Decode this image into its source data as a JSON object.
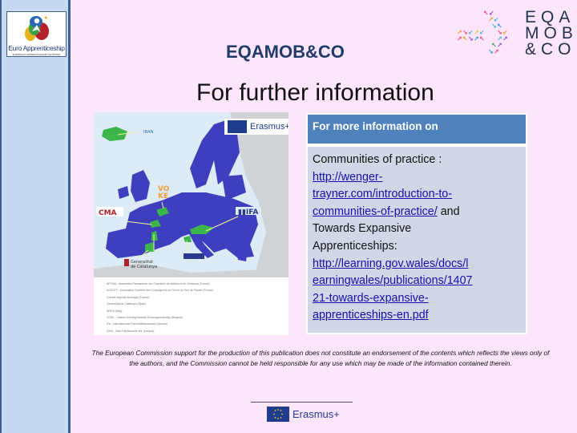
{
  "header": {
    "project_title": "EQAMOB&CO",
    "page_title": "For further information"
  },
  "logos": {
    "left": {
      "name": "Euro Apprenticeship",
      "subtitle": "EUROPEAN APPRENTICESHIP NETWORK"
    },
    "right": {
      "lines": [
        "EQA",
        "MOB",
        "&CO"
      ]
    }
  },
  "map": {
    "badge_label": "Erasmus+",
    "callouts": [
      "VOKE",
      "CMA",
      "IFA",
      "Generalitat de Catalunya",
      "WSKS"
    ],
    "legend": [
      "APCMA - Assemblée Permanente des Chambres de Métiers et de l'Artisanat (France)",
      "AOCDTF - Association Ouvrière des Compagnons du Devoir du Tour de France (France)",
      "Conseil régional Auvergne (France)",
      "Generalitat de Catalunya (Spain)",
      "WSKS (Italy)",
      "VOKE - Vlaams Overleg Kwaliteit Ervaringsonderwijs (Belgium)",
      "IFA - Internationaler Fachkräfteaustausch (Austria)",
      "IDAN - Iðan Fræðslusetur ehf. (Iceland)"
    ],
    "colors": {
      "participant": "#3d3fbf",
      "partner": "#3cb54a",
      "sea": "#dcebf5",
      "land": "#cfd3d6"
    }
  },
  "info": {
    "header": "For more information on",
    "topic1": "Communities of practice :",
    "link1": "http://wenger-trayner.com/introduction-to-communities-of-practice/",
    "link1_lines": [
      "http://wenger-",
      "trayner.com/introduction-to-",
      "communities-of-practice/"
    ],
    "connector": " and",
    "topic2_lines": [
      "Towards Expansive",
      "Apprenticeships:"
    ],
    "link2": "http://learning.gov.wales/docs/learningwales/publications/140721-towards-expansive-apprenticeships-en.pdf",
    "link2_lines": [
      "http://learning.gov.wales/docs/l",
      "earningwales/publications/1407",
      "21-towards-expansive-",
      "apprenticeships-en.pdf"
    ]
  },
  "footer": {
    "disclaimer": "The European Commission support for the production of this publication does not constitute an endorsement of the contents which reflects the views only of the authors, and the Commission cannot be held responsible for any use which may be made of the information contained therein.",
    "erasmus_label": "Erasmus+"
  },
  "colors": {
    "background": "#fde6fb",
    "sidebar": "#c6d9f1",
    "sidebar_border": "#3c5f8f",
    "table_header": "#4f81bd",
    "table_body": "#d0d8e8",
    "title": "#1f3b6a",
    "link": "#1a0dab"
  }
}
